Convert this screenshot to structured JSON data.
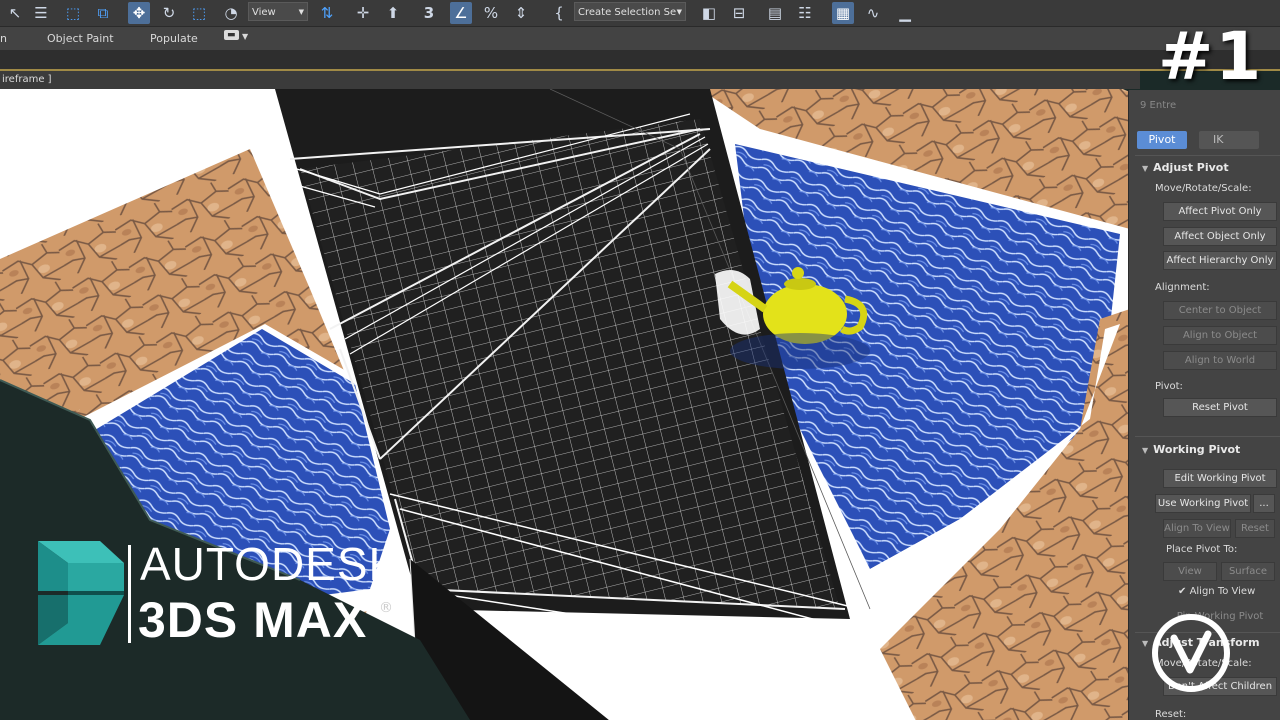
{
  "toolbar": {
    "view_dropdown": "View",
    "selection_set_dropdown": "Create Selection Se",
    "icons": [
      "select-icon",
      "select-by-name-icon",
      "rect-select-icon",
      "window-crossing-icon",
      "move-icon",
      "rotate-icon",
      "scale-icon",
      "select-manipulate-icon",
      "reference-coord-icon",
      "pivot-center-icon",
      "select-link-icon",
      "snap-3d-icon",
      "angle-snap-icon",
      "percent-snap-icon",
      "spinner-snap-icon",
      "named-selection-icon",
      "mirror-icon",
      "align-icon",
      "scene-explorer-icon",
      "layer-explorer-icon",
      "ribbon-toggle-icon",
      "curve-editor-icon",
      "schematic-view-icon"
    ]
  },
  "ribbon": {
    "tabs": [
      "n",
      "Object Paint",
      "Populate"
    ]
  },
  "viewport": {
    "label": "ireframe ]"
  },
  "command_panel": {
    "top_cut_label": "9 Entre",
    "tab_pivot": "Pivot",
    "tab_ik": "IK",
    "adjust_pivot": {
      "title": "Adjust Pivot",
      "move_label": "Move/Rotate/Scale:",
      "affect_pivot": "Affect Pivot Only",
      "affect_object": "Affect Object Only",
      "affect_hierarchy": "Affect Hierarchy Only",
      "alignment_label": "Alignment:",
      "center_to_object": "Center to Object",
      "align_to_object": "Align to Object",
      "align_to_world": "Align to World",
      "pivot_label": "Pivot:",
      "reset_pivot": "Reset Pivot"
    },
    "working_pivot": {
      "title": "Working Pivot",
      "edit": "Edit Working Pivot",
      "use": "Use Working Pivot",
      "more": "...",
      "align_to_view": "Align To View",
      "reset": "Reset",
      "place_label": "Place Pivot To:",
      "view": "View",
      "surface": "Surface",
      "align_to_view_check": "Align To View",
      "pin": "Pin Working Pivot"
    },
    "adjust_transform": {
      "title": "Adjust Transform",
      "move_label": "Move/Rotate/Scale:",
      "dont_affect": "Don't Affect Children",
      "reset_label": "Reset:"
    }
  },
  "branding": {
    "episode": "#1",
    "line1": "AUTODESK",
    "line2": "3DS MAX",
    "registered": "®"
  },
  "colors": {
    "panel_bg": "#444444",
    "accent_blue": "#5b8dd6",
    "pool_water": "#2c50b8",
    "teapot_yellow": "#e6e620",
    "logo_teal": "#1f8e8a"
  }
}
